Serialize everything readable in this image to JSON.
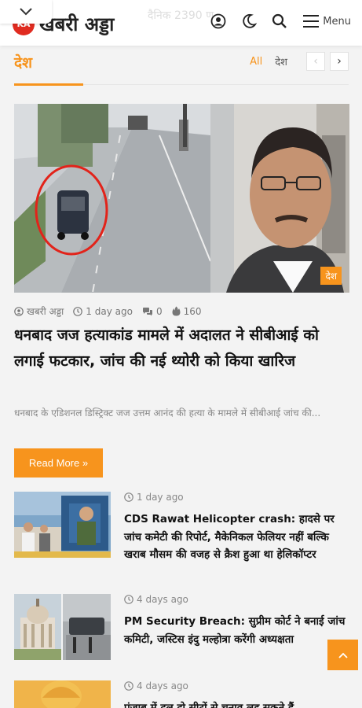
{
  "header": {
    "logo_mark": "KA",
    "logo_text": "खबरी अड्डा",
    "ticker_faint": "दैनिक 2390 ण",
    "menu_label": "Menu",
    "icons": [
      "user-icon",
      "moon-icon",
      "search-icon",
      "hamburger-icon"
    ],
    "collapse_icon": "chevron-down-icon"
  },
  "section": {
    "title": "देश",
    "filters": [
      "All",
      "देश"
    ],
    "prev_label": "‹",
    "next_label": "›"
  },
  "featured": {
    "category": "देश",
    "author": "खबरी अड्डा",
    "time": "1 day ago",
    "comments": "0",
    "views": "160",
    "title": "धनबाद जज हत्याकांड मामले में अदालत ने सीबीआई को लगाई फटकार, जांच की नई थ्योरी को किया खारिज",
    "excerpt": "धनबाद के एडिशनल डिस्ट्रिक्ट जज उत्तम आनंद की हत्या के मामले में सीबीआई जांच की...",
    "read_more": "Read More »"
  },
  "list": [
    {
      "time": "1 day ago",
      "title": "CDS Rawat Helicopter crash: हादसे पर जांच कमेटी की रिपोर्ट, मैकेनिकल फेलियर नहीं बल्कि खराब मौसम की वजह से क्रैश हुआ था हेलिकॉप्टर"
    },
    {
      "time": "4 days ago",
      "title": "PM Security Breach: सुप्रीम कोर्ट ने बनाई जांच कमिटी, जस्टिस इंदु मल्होत्रा करेंगी अध्यक्षता"
    },
    {
      "time": "4 days ago",
      "title": "पंजाब में दल दो सीटों से चुनाव लड़ सकते हैं"
    }
  ],
  "colors": {
    "accent": "#f7941d",
    "logo_red": "#e02b20"
  },
  "back_to_top_icon": "chevron-up-icon"
}
